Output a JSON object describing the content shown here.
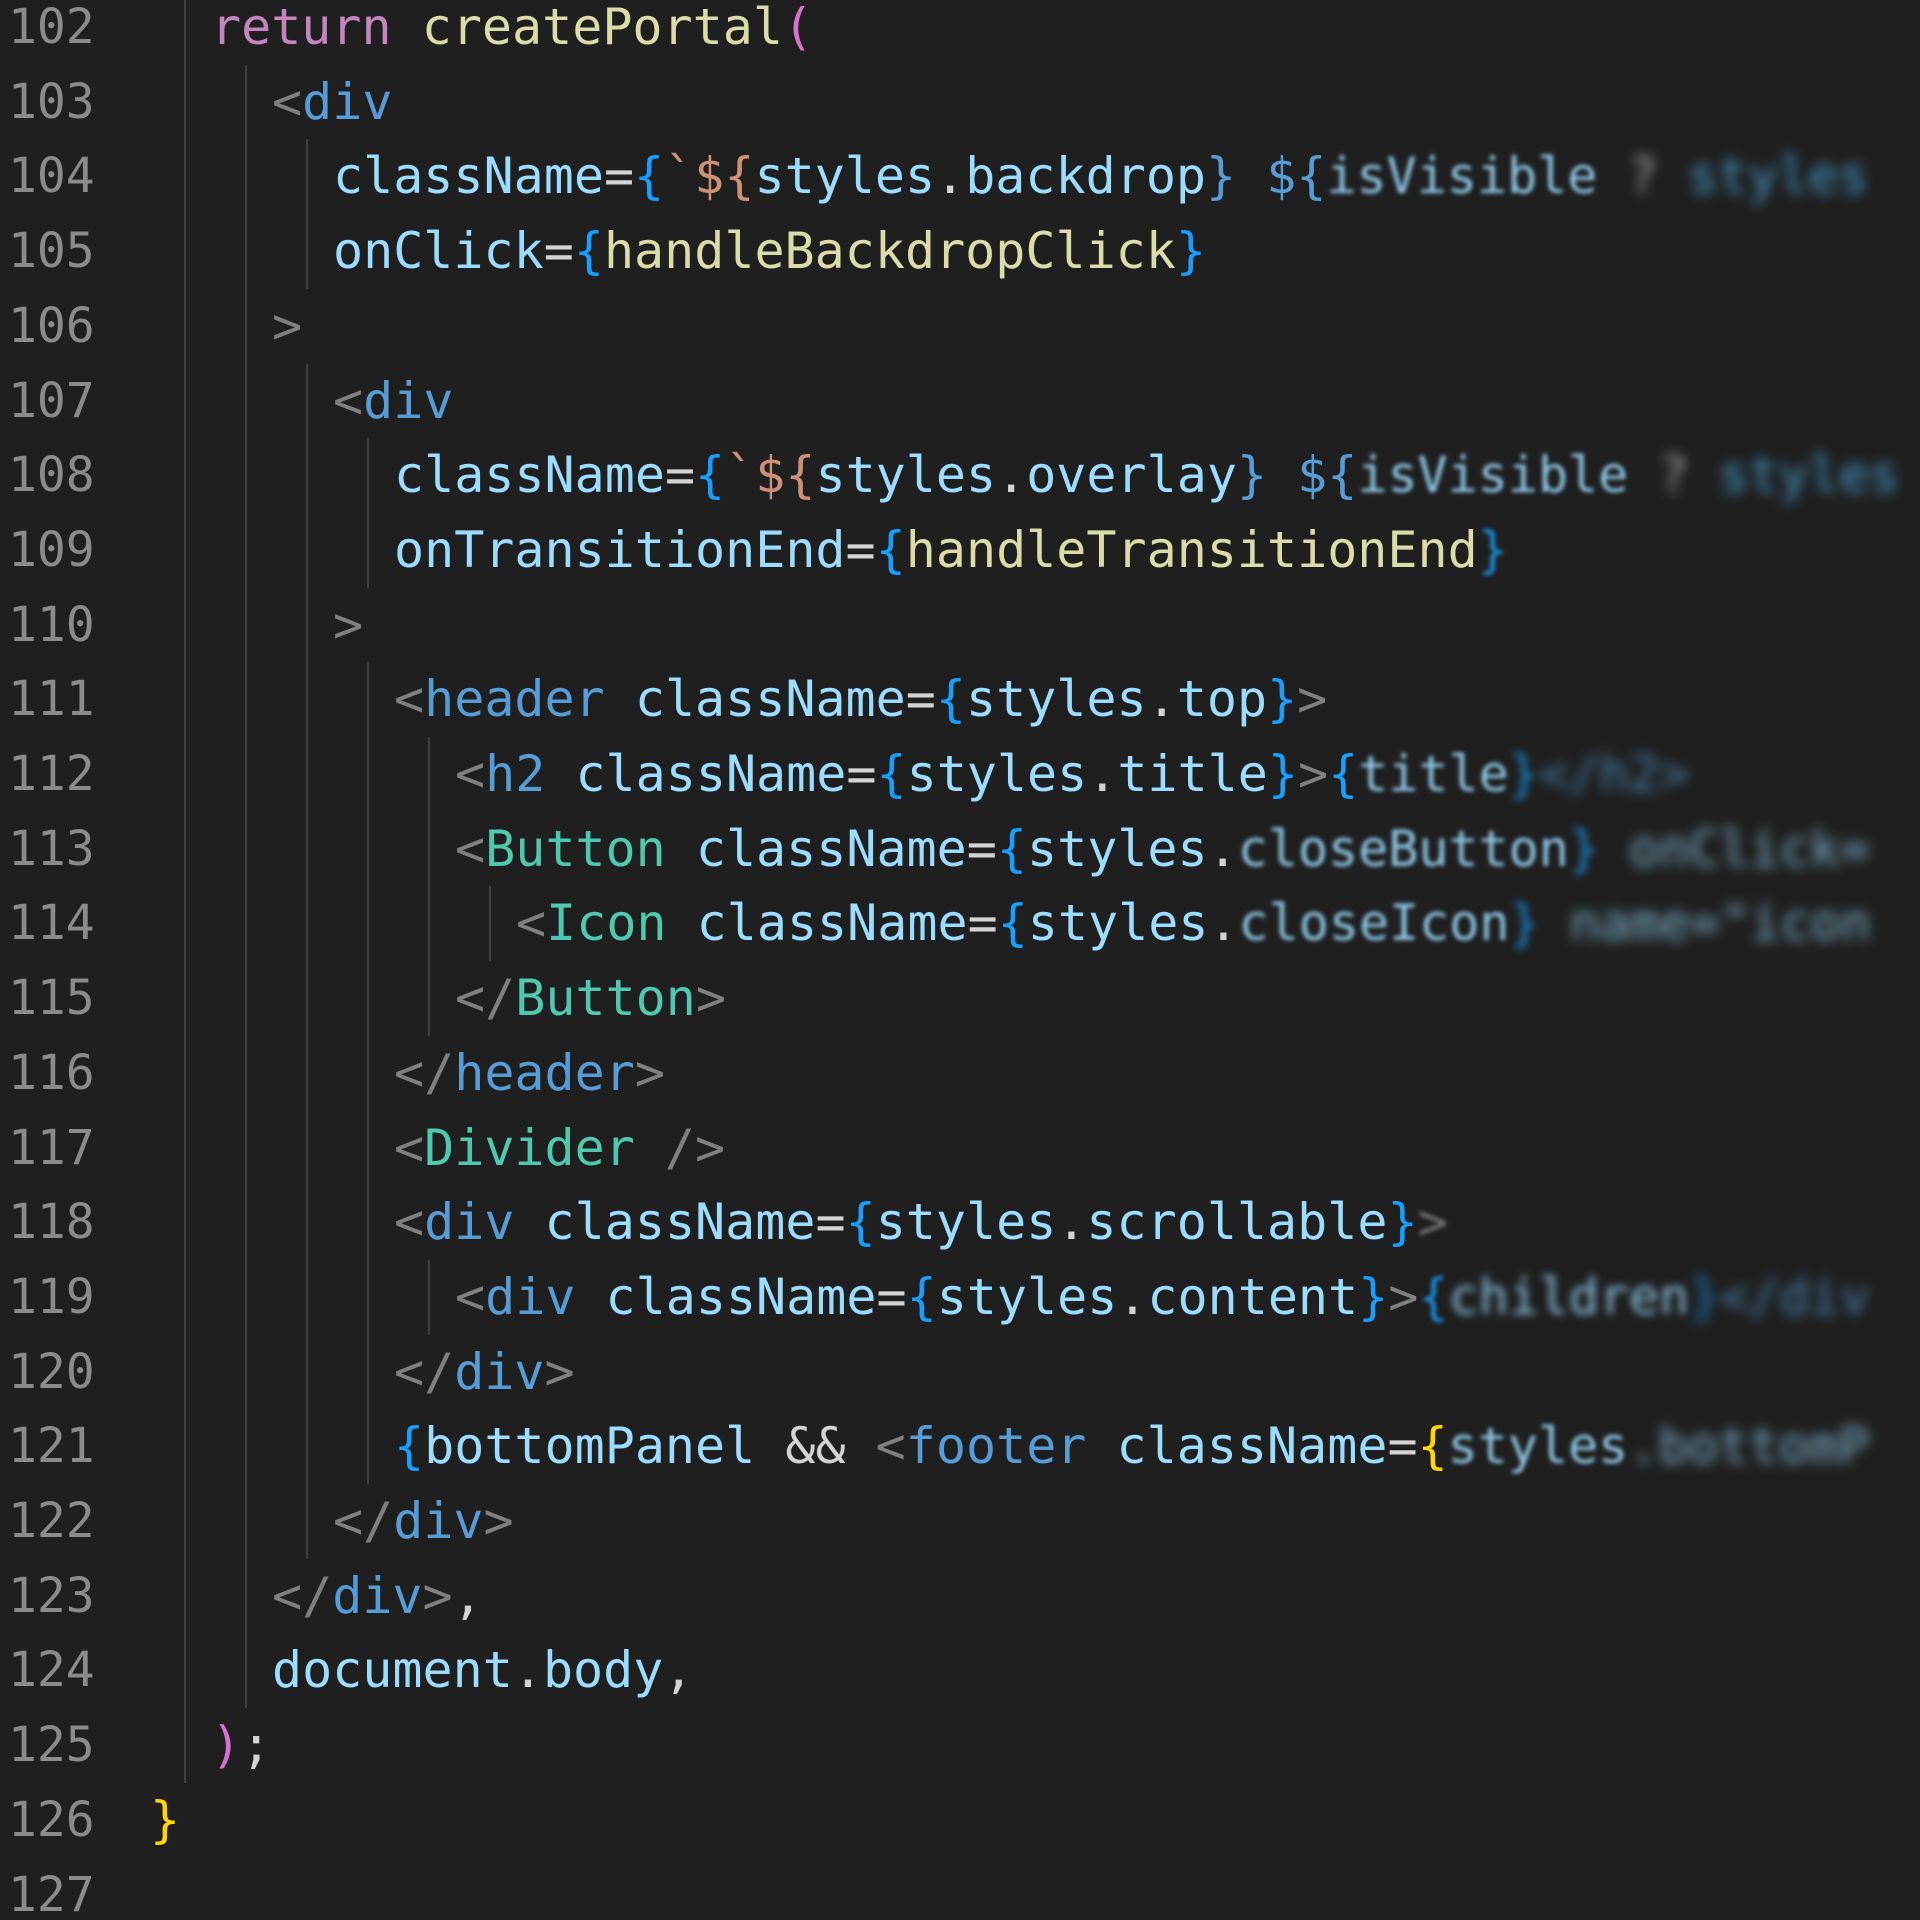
{
  "editor": {
    "background": "#1f1f1f",
    "theme_colors": {
      "keyword": "#c586c0",
      "function": "#dcdcaa",
      "tag_bracket": "#808080",
      "html_tag": "#569cd6",
      "component": "#4ec9b0",
      "attribute": "#9cdcfe",
      "variable": "#9cdcfe",
      "brace_level1": "#ffd700",
      "brace_level2": "#da70d6",
      "brace_level3": "#179fff",
      "plain": "#d4d4d4",
      "line_number": "#8b8b8b"
    },
    "lines": [
      {
        "n": "102",
        "indent": 1,
        "tokens": [
          {
            "t": "return ",
            "c": "#c586c0"
          },
          {
            "t": "createPortal",
            "c": "#dcdcaa"
          },
          {
            "t": "(",
            "c": "#da70d6"
          }
        ]
      },
      {
        "n": "103",
        "indent": 2,
        "tokens": [
          {
            "t": "<",
            "c": "#808080"
          },
          {
            "t": "div",
            "c": "#569cd6"
          }
        ]
      },
      {
        "n": "104",
        "indent": 3,
        "tokens": [
          {
            "t": "className",
            "c": "#9cdcfe"
          },
          {
            "t": "=",
            "c": "#d4d4d4"
          },
          {
            "t": "{",
            "c": "#179fff"
          },
          {
            "t": "`${",
            "c": "#ce9178"
          },
          {
            "t": "styles",
            "c": "#9cdcfe"
          },
          {
            "t": ".",
            "c": "#d4d4d4"
          },
          {
            "t": "backdrop",
            "c": "#9cdcfe"
          },
          {
            "t": "} ${",
            "c": "#569cd6"
          },
          {
            "t": "isVisible",
            "c": "#9cdcfe",
            "b": 1
          },
          {
            "t": " ? ",
            "c": "#d4d4d4",
            "b": 3
          },
          {
            "t": "styles",
            "c": "#4fc1ff",
            "b": 3
          }
        ]
      },
      {
        "n": "105",
        "indent": 3,
        "tokens": [
          {
            "t": "onClick",
            "c": "#9cdcfe"
          },
          {
            "t": "=",
            "c": "#d4d4d4"
          },
          {
            "t": "{",
            "c": "#179fff"
          },
          {
            "t": "handleBackdropClick",
            "c": "#dcdcaa"
          },
          {
            "t": "}",
            "c": "#179fff"
          }
        ]
      },
      {
        "n": "106",
        "indent": 2,
        "tokens": [
          {
            "t": ">",
            "c": "#808080"
          }
        ]
      },
      {
        "n": "107",
        "indent": 3,
        "tokens": [
          {
            "t": "<",
            "c": "#808080"
          },
          {
            "t": "div",
            "c": "#569cd6"
          }
        ]
      },
      {
        "n": "108",
        "indent": 4,
        "tokens": [
          {
            "t": "className",
            "c": "#9cdcfe"
          },
          {
            "t": "=",
            "c": "#d4d4d4"
          },
          {
            "t": "{",
            "c": "#179fff"
          },
          {
            "t": "`${",
            "c": "#ce9178"
          },
          {
            "t": "styles",
            "c": "#9cdcfe"
          },
          {
            "t": ".",
            "c": "#d4d4d4"
          },
          {
            "t": "overlay",
            "c": "#9cdcfe"
          },
          {
            "t": "} ${",
            "c": "#569cd6"
          },
          {
            "t": "isVisible",
            "c": "#9cdcfe",
            "b": 1
          },
          {
            "t": " ? ",
            "c": "#d4d4d4",
            "b": 3
          },
          {
            "t": "styles",
            "c": "#4fc1ff",
            "b": 3
          }
        ]
      },
      {
        "n": "109",
        "indent": 4,
        "tokens": [
          {
            "t": "onTransitionEnd",
            "c": "#9cdcfe"
          },
          {
            "t": "=",
            "c": "#d4d4d4"
          },
          {
            "t": "{",
            "c": "#179fff"
          },
          {
            "t": "handleTransitionEnd",
            "c": "#dcdcaa"
          },
          {
            "t": "}",
            "c": "#179fff",
            "b": 1
          }
        ]
      },
      {
        "n": "110",
        "indent": 3,
        "tokens": [
          {
            "t": ">",
            "c": "#808080"
          }
        ]
      },
      {
        "n": "111",
        "indent": 4,
        "tokens": [
          {
            "t": "<",
            "c": "#808080"
          },
          {
            "t": "header",
            "c": "#569cd6"
          },
          {
            "t": " ",
            "c": "#d4d4d4"
          },
          {
            "t": "className",
            "c": "#9cdcfe"
          },
          {
            "t": "=",
            "c": "#d4d4d4"
          },
          {
            "t": "{",
            "c": "#179fff"
          },
          {
            "t": "styles",
            "c": "#9cdcfe"
          },
          {
            "t": ".",
            "c": "#d4d4d4"
          },
          {
            "t": "top",
            "c": "#9cdcfe"
          },
          {
            "t": "}",
            "c": "#179fff"
          },
          {
            "t": ">",
            "c": "#808080"
          }
        ]
      },
      {
        "n": "112",
        "indent": 5,
        "tokens": [
          {
            "t": "<",
            "c": "#808080"
          },
          {
            "t": "h2",
            "c": "#569cd6"
          },
          {
            "t": " ",
            "c": "#d4d4d4"
          },
          {
            "t": "className",
            "c": "#9cdcfe"
          },
          {
            "t": "=",
            "c": "#d4d4d4"
          },
          {
            "t": "{",
            "c": "#179fff"
          },
          {
            "t": "styles",
            "c": "#9cdcfe"
          },
          {
            "t": ".",
            "c": "#d4d4d4"
          },
          {
            "t": "title",
            "c": "#9cdcfe"
          },
          {
            "t": "}",
            "c": "#179fff"
          },
          {
            "t": ">",
            "c": "#808080"
          },
          {
            "t": "{",
            "c": "#179fff"
          },
          {
            "t": "title",
            "c": "#9cdcfe",
            "b": 1
          },
          {
            "t": "}",
            "c": "#179fff",
            "b": 2
          },
          {
            "t": "</h2>",
            "c": "#569cd6",
            "b": 3
          }
        ]
      },
      {
        "n": "113",
        "indent": 5,
        "tokens": [
          {
            "t": "<",
            "c": "#808080"
          },
          {
            "t": "Button",
            "c": "#4ec9b0"
          },
          {
            "t": " ",
            "c": "#d4d4d4"
          },
          {
            "t": "className",
            "c": "#9cdcfe"
          },
          {
            "t": "=",
            "c": "#d4d4d4"
          },
          {
            "t": "{",
            "c": "#179fff"
          },
          {
            "t": "styles",
            "c": "#9cdcfe"
          },
          {
            "t": ".",
            "c": "#d4d4d4"
          },
          {
            "t": "closeButton",
            "c": "#9cdcfe",
            "b": 1
          },
          {
            "t": "}",
            "c": "#179fff",
            "b": 2
          },
          {
            "t": " onClick=",
            "c": "#9cdcfe",
            "b": 3
          }
        ]
      },
      {
        "n": "114",
        "indent": 6,
        "tokens": [
          {
            "t": "<",
            "c": "#808080"
          },
          {
            "t": "Icon",
            "c": "#4ec9b0"
          },
          {
            "t": " ",
            "c": "#d4d4d4"
          },
          {
            "t": "className",
            "c": "#9cdcfe"
          },
          {
            "t": "=",
            "c": "#d4d4d4"
          },
          {
            "t": "{",
            "c": "#179fff"
          },
          {
            "t": "styles",
            "c": "#9cdcfe"
          },
          {
            "t": ".",
            "c": "#d4d4d4"
          },
          {
            "t": "closeIcon",
            "c": "#9cdcfe",
            "b": 1
          },
          {
            "t": "}",
            "c": "#179fff",
            "b": 2
          },
          {
            "t": " name=\"icon",
            "c": "#9cdcfe",
            "b": 3
          }
        ]
      },
      {
        "n": "115",
        "indent": 5,
        "tokens": [
          {
            "t": "</",
            "c": "#808080"
          },
          {
            "t": "Button",
            "c": "#4ec9b0"
          },
          {
            "t": ">",
            "c": "#808080"
          }
        ]
      },
      {
        "n": "116",
        "indent": 4,
        "tokens": [
          {
            "t": "</",
            "c": "#808080"
          },
          {
            "t": "header",
            "c": "#569cd6"
          },
          {
            "t": ">",
            "c": "#808080"
          }
        ]
      },
      {
        "n": "117",
        "indent": 4,
        "tokens": [
          {
            "t": "<",
            "c": "#808080"
          },
          {
            "t": "Divider",
            "c": "#4ec9b0"
          },
          {
            "t": " />",
            "c": "#808080"
          }
        ]
      },
      {
        "n": "118",
        "indent": 4,
        "tokens": [
          {
            "t": "<",
            "c": "#808080"
          },
          {
            "t": "div",
            "c": "#569cd6"
          },
          {
            "t": " ",
            "c": "#d4d4d4"
          },
          {
            "t": "className",
            "c": "#9cdcfe"
          },
          {
            "t": "=",
            "c": "#d4d4d4"
          },
          {
            "t": "{",
            "c": "#179fff"
          },
          {
            "t": "styles",
            "c": "#9cdcfe"
          },
          {
            "t": ".",
            "c": "#d4d4d4"
          },
          {
            "t": "scrollable",
            "c": "#9cdcfe"
          },
          {
            "t": "}",
            "c": "#179fff"
          },
          {
            "t": ">",
            "c": "#808080",
            "b": 1
          }
        ]
      },
      {
        "n": "119",
        "indent": 5,
        "tokens": [
          {
            "t": "<",
            "c": "#808080"
          },
          {
            "t": "div",
            "c": "#569cd6"
          },
          {
            "t": " ",
            "c": "#d4d4d4"
          },
          {
            "t": "className",
            "c": "#9cdcfe"
          },
          {
            "t": "=",
            "c": "#d4d4d4"
          },
          {
            "t": "{",
            "c": "#179fff"
          },
          {
            "t": "styles",
            "c": "#9cdcfe"
          },
          {
            "t": ".",
            "c": "#d4d4d4"
          },
          {
            "t": "content",
            "c": "#9cdcfe"
          },
          {
            "t": "}",
            "c": "#179fff"
          },
          {
            "t": ">",
            "c": "#808080"
          },
          {
            "t": "{",
            "c": "#179fff",
            "b": 1
          },
          {
            "t": "children",
            "c": "#9cdcfe",
            "b": 2
          },
          {
            "t": "}",
            "c": "#179fff",
            "b": 3
          },
          {
            "t": "</div",
            "c": "#569cd6",
            "b": 3
          }
        ]
      },
      {
        "n": "120",
        "indent": 4,
        "tokens": [
          {
            "t": "</",
            "c": "#808080"
          },
          {
            "t": "div",
            "c": "#569cd6"
          },
          {
            "t": ">",
            "c": "#808080"
          }
        ]
      },
      {
        "n": "121",
        "indent": 4,
        "tokens": [
          {
            "t": "{",
            "c": "#179fff"
          },
          {
            "t": "bottomPanel",
            "c": "#9cdcfe"
          },
          {
            "t": " && ",
            "c": "#d4d4d4"
          },
          {
            "t": "<",
            "c": "#808080"
          },
          {
            "t": "footer",
            "c": "#569cd6"
          },
          {
            "t": " ",
            "c": "#d4d4d4"
          },
          {
            "t": "className",
            "c": "#9cdcfe"
          },
          {
            "t": "=",
            "c": "#d4d4d4"
          },
          {
            "t": "{",
            "c": "#ffd700"
          },
          {
            "t": "styles",
            "c": "#9cdcfe",
            "b": 1
          },
          {
            "t": ".bottomP",
            "c": "#9cdcfe",
            "b": 3
          }
        ]
      },
      {
        "n": "122",
        "indent": 3,
        "tokens": [
          {
            "t": "</",
            "c": "#808080"
          },
          {
            "t": "div",
            "c": "#569cd6"
          },
          {
            "t": ">",
            "c": "#808080"
          }
        ]
      },
      {
        "n": "123",
        "indent": 2,
        "tokens": [
          {
            "t": "</",
            "c": "#808080"
          },
          {
            "t": "div",
            "c": "#569cd6"
          },
          {
            "t": ">",
            "c": "#808080"
          },
          {
            "t": ",",
            "c": "#d4d4d4"
          }
        ]
      },
      {
        "n": "124",
        "indent": 2,
        "tokens": [
          {
            "t": "document",
            "c": "#9cdcfe"
          },
          {
            "t": ".",
            "c": "#d4d4d4"
          },
          {
            "t": "body",
            "c": "#9cdcfe"
          },
          {
            "t": ",",
            "c": "#d4d4d4"
          }
        ]
      },
      {
        "n": "125",
        "indent": 1,
        "tokens": [
          {
            "t": ")",
            "c": "#da70d6"
          },
          {
            "t": ";",
            "c": "#d4d4d4"
          }
        ]
      },
      {
        "n": "126",
        "indent": 0,
        "tokens": [
          {
            "t": "}",
            "c": "#ffd700"
          }
        ]
      },
      {
        "n": "127",
        "indent": 0,
        "tokens": []
      }
    ]
  }
}
